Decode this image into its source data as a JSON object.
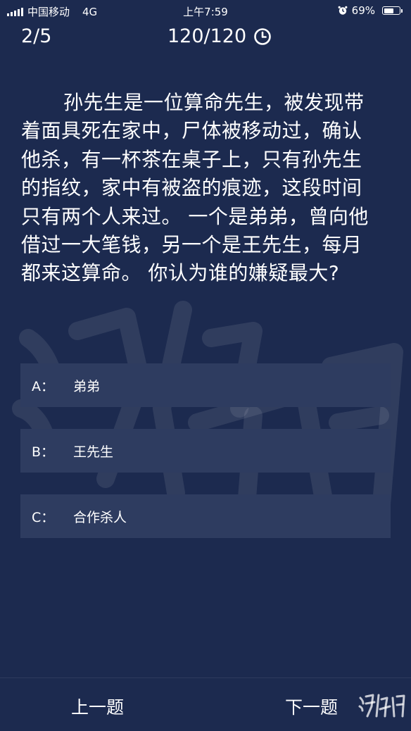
{
  "status_bar": {
    "carrier": "中国移动",
    "network": "4G",
    "time": "上午7:59",
    "battery_percent": "69%",
    "battery_level": 0.69
  },
  "header": {
    "progress": "2/5",
    "timer": "120/120"
  },
  "question": {
    "text": "孙先生是一位算命先生，被发现带着面具死在家中，尸体被移动过，确认他杀，有一杯茶在桌子上，只有孙先生的指纹，家中有被盗的痕迹，这段时间只有两个人来过。 一个是弟弟，曾向他借过一大笔钱，另一个是王先生，每月都来这算命。 你认为谁的嫌疑最大?"
  },
  "options": [
    {
      "letter": "A：",
      "text": "弟弟"
    },
    {
      "letter": "B：",
      "text": "王先生"
    },
    {
      "letter": "C：",
      "text": "合作杀人"
    }
  ],
  "nav": {
    "prev": "上一题",
    "next": "下一题"
  },
  "colors": {
    "background": "#1c2a4f",
    "option_background": "#2e3c60",
    "text": "#ffffff"
  }
}
